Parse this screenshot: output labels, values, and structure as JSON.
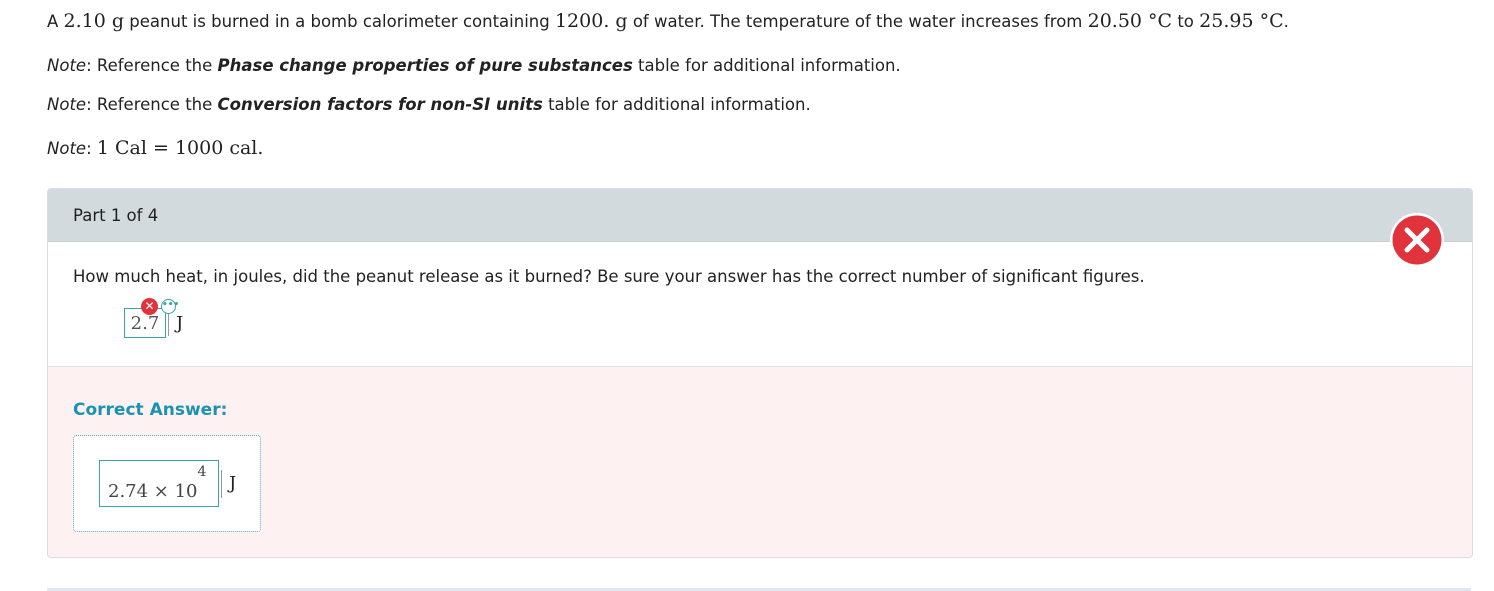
{
  "problem": {
    "prefix": "A ",
    "mass": "2.10 g",
    "mid1": " peanut is burned in a bomb calorimeter containing ",
    "water_mass": "1200. g",
    "mid2": " of water. The temperature of the water increases from ",
    "t_initial": "20.50 °C",
    "mid3": " to ",
    "t_final": "25.95 °C",
    "suffix": "."
  },
  "notes": [
    {
      "label": "Note",
      "pre": ": Reference the ",
      "bold": "Phase change properties of pure substances",
      "post": " table for additional information."
    },
    {
      "label": "Note",
      "pre": ": Reference the ",
      "bold": "Conversion factors for non-SI units",
      "post": " table for additional information."
    }
  ],
  "note3": {
    "label": "Note",
    "sep": ": ",
    "math": "1 Cal = 1000 cal",
    "post": "."
  },
  "part": {
    "header": "Part 1 of 4"
  },
  "question": "How much heat, in joules, did the peanut release as it burned? Be sure your answer has the correct number of significant figures.",
  "student_answer": {
    "value": "2.7",
    "unit": "J",
    "wrong_mark": "✕",
    "more": "•••"
  },
  "correct": {
    "label": "Correct Answer:",
    "mantissa": "2.74 × 10",
    "exponent": "4",
    "unit": "J"
  },
  "colors": {
    "accent": "#1a93b0",
    "error": "#e0333c",
    "header_bg": "#d3dade",
    "correct_bg": "#fdf1f1"
  },
  "icons": {
    "status": "incorrect-x-icon"
  }
}
